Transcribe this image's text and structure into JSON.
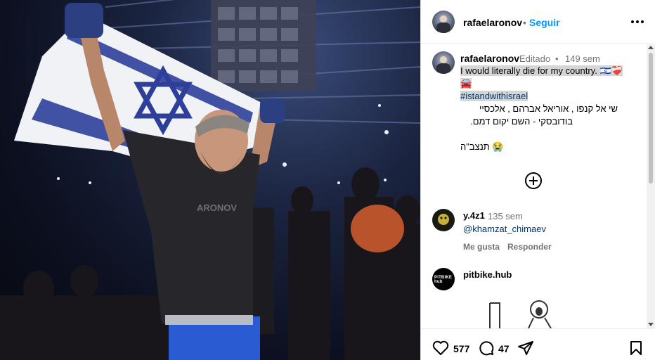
{
  "post": {
    "username": "rafaelaronov",
    "follow_label": "Seguir",
    "separator": "•"
  },
  "caption": {
    "username": "rafaelaronov",
    "edited_label": "Editado",
    "time": "149 sem",
    "line1": "I would literally die for my country. 🇮🇱❤️‍🩹",
    "line1_emoji": "🚘",
    "hashtag": "#istandwithisrael",
    "hebrew1": "שי אל קנפו , אוריאל אברהם , אלכסיי",
    "hebrew2": "בודובסקי - השם יקום דמם.",
    "hebrew3": "תנצב\"ה",
    "hebrew3_emoji": "😭"
  },
  "comments": [
    {
      "username": "y.4z1",
      "time": "135 sem",
      "text": "@khamzat_chimaev",
      "like_label": "Me gusta",
      "reply_label": "Responder"
    },
    {
      "username": "pitbike.hub",
      "avatar_text": "PITBIKE hub"
    }
  ],
  "footer": {
    "likes": "577",
    "comment_count": "47"
  },
  "icons": {
    "more": "more-options-icon",
    "load_more": "load-more-comments-icon",
    "like": "heart-icon",
    "comment": "comment-icon",
    "share": "share-icon",
    "save": "bookmark-icon"
  },
  "colors": {
    "accent": "#0095f6",
    "link": "#00376b",
    "muted": "#737373",
    "highlight": "#d5d5d5"
  }
}
